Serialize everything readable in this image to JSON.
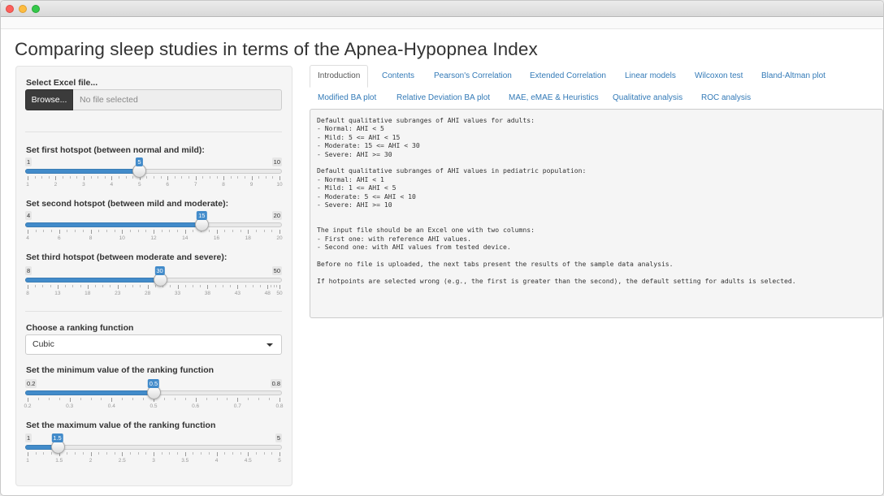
{
  "title": "Comparing sleep studies in terms of the Apnea-Hypopnea Index",
  "sidebar": {
    "file_label": "Select Excel file...",
    "browse_label": "Browse...",
    "file_placeholder": "No file selected",
    "sliders": [
      {
        "label": "Set first hotspot (between normal and mild):",
        "min": "1",
        "max": "10",
        "value": "5",
        "fraction": 0.4444,
        "ticks": [
          "1",
          "2",
          "3",
          "4",
          "5",
          "6",
          "7",
          "8",
          "9",
          "10"
        ]
      },
      {
        "label": "Set second hotspot (between mild and moderate):",
        "min": "4",
        "max": "20",
        "value": "15",
        "fraction": 0.6875,
        "ticks": [
          "4",
          "6",
          "8",
          "10",
          "12",
          "14",
          "16",
          "18",
          "20"
        ]
      },
      {
        "label": "Set third hotspot (between moderate and severe):",
        "min": "8",
        "max": "50",
        "value": "30",
        "fraction": 0.5238,
        "ticks": [
          "8",
          "13",
          "18",
          "23",
          "28",
          "33",
          "38",
          "43",
          "48",
          "50"
        ]
      },
      {
        "label": "Set the minimum value of the ranking function",
        "min": "0.2",
        "max": "0.8",
        "value": "0.5",
        "fraction": 0.5,
        "ticks": [
          "0.2",
          "0.3",
          "0.4",
          "0.5",
          "0.6",
          "0.7",
          "0.8"
        ]
      },
      {
        "label": "Set the maximum value of the ranking function",
        "min": "1",
        "max": "5",
        "value": "1.5",
        "fraction": 0.125,
        "ticks": [
          "1",
          "1.5",
          "2",
          "2.5",
          "3",
          "3.5",
          "4",
          "4.5",
          "5"
        ]
      }
    ],
    "ranking_label": "Choose a ranking function",
    "ranking_value": "Cubic"
  },
  "tabs": {
    "row1": [
      "Introduction",
      "Contents",
      "Pearson's Correlation",
      "Extended Correlation",
      "Linear models",
      "Wilcoxon test",
      "Bland-Altman plot"
    ],
    "row2": [
      "Modified BA plot",
      "Relative Deviation BA plot",
      "MAE, eMAE & Heuristics",
      "Qualitative analysis",
      "ROC analysis"
    ],
    "active": "Introduction"
  },
  "content": "Default qualitative subranges of AHI values for adults:\n- Normal: AHI < 5\n- Mild: 5 <= AHI < 15\n- Moderate: 15 <= AHI < 30\n- Severe: AHI >= 30\n\nDefault qualitative subranges of AHI values in pediatric population:\n- Normal: AHI < 1\n- Mild: 1 <= AHI < 5\n- Moderate: 5 <= AHI < 10\n- Severe: AHI >= 10\n\n\nThe input file should be an Excel one with two columns:\n- First one: with reference AHI values.\n- Second one: with AHI values from tested device.\n\nBefore no file is uploaded, the next tabs present the results of the sample data analysis.\n\nIf hotpoints are selected wrong (e.g., the first is greater than the second), the default setting for adults is selected.",
  "colors": {
    "accent": "#428bca",
    "link": "#337ab7"
  }
}
